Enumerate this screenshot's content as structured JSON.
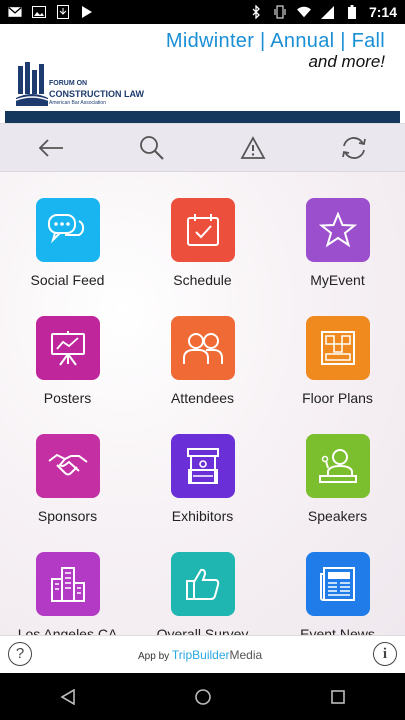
{
  "status_bar": {
    "time": "7:14",
    "icons": [
      "gmail-icon",
      "image-icon",
      "download-icon",
      "play-store-icon",
      "bluetooth-icon",
      "vibrate-icon",
      "wifi-icon",
      "signal-icon",
      "battery-icon"
    ]
  },
  "banner": {
    "line1": "Midwinter | Annual | Fall",
    "line2": "and more!",
    "logo_line1": "FORUM ON",
    "logo_line2": "CONSTRUCTION LAW",
    "logo_line3": "American Bar Association",
    "colors": {
      "accent": "#1a8fd6",
      "navy": "#14385c"
    }
  },
  "toolbar": {
    "buttons": [
      "back-arrow-icon",
      "search-icon",
      "alert-icon",
      "refresh-icon"
    ]
  },
  "tiles": [
    {
      "label": "Social Feed",
      "icon": "chat-bubbles-icon",
      "color": "#19b5f0"
    },
    {
      "label": "Schedule",
      "icon": "calendar-check-icon",
      "color": "#ec4f3c"
    },
    {
      "label": "MyEvent",
      "icon": "star-icon",
      "color": "#9b4fcc"
    },
    {
      "label": "Posters",
      "icon": "easel-chart-icon",
      "color": "#c0269b"
    },
    {
      "label": "Attendees",
      "icon": "people-icon",
      "color": "#ef6a35"
    },
    {
      "label": "Floor Plans",
      "icon": "floor-plan-icon",
      "color": "#f08a1e"
    },
    {
      "label": "Sponsors",
      "icon": "handshake-icon",
      "color": "#c42fa3"
    },
    {
      "label": "Exhibitors",
      "icon": "booth-icon",
      "color": "#6a2fd6"
    },
    {
      "label": "Speakers",
      "icon": "speaker-icon",
      "color": "#7bbf2e"
    },
    {
      "label": "Los Angeles CA",
      "icon": "city-buildings-icon",
      "color": "#b23ac4"
    },
    {
      "label": "Overall Survey",
      "icon": "thumbs-up-icon",
      "color": "#1fb5b0"
    },
    {
      "label": "Event News",
      "icon": "newspaper-icon",
      "color": "#1f7ce8"
    }
  ],
  "footer": {
    "help": "?",
    "info": "i",
    "app_by": "App by",
    "brand_part1": "TripBuilder",
    "brand_part2": "Media"
  },
  "nav_bar": {
    "buttons": [
      "back-triangle-icon",
      "home-circle-icon",
      "recents-square-icon"
    ]
  }
}
